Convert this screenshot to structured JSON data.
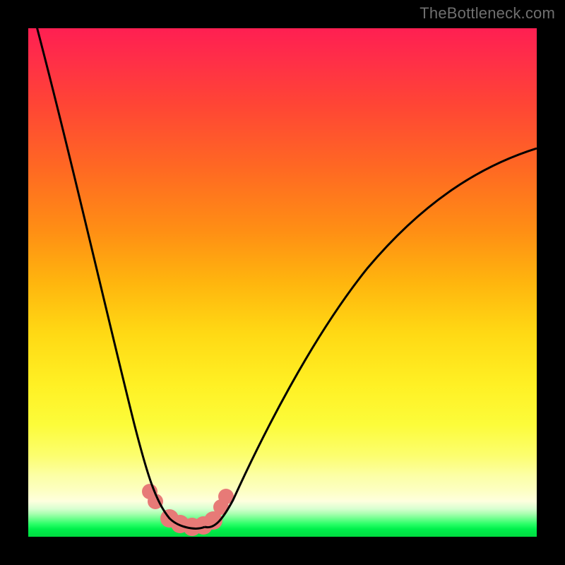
{
  "watermark": "TheBottleneck.com",
  "chart_data": {
    "type": "line",
    "title": "",
    "xlabel": "",
    "ylabel": "",
    "xlim": [
      0,
      100
    ],
    "ylim": [
      0,
      100
    ],
    "grid": false,
    "legend": false,
    "series": [
      {
        "name": "left-curve",
        "x": [
          0,
          4,
          8,
          12,
          16,
          19,
          22,
          24,
          26,
          27,
          28,
          30
        ],
        "values": [
          100,
          84,
          68,
          52,
          36,
          22,
          11,
          5,
          2,
          1,
          0,
          0
        ]
      },
      {
        "name": "right-curve",
        "x": [
          30,
          32,
          35,
          38,
          42,
          47,
          53,
          60,
          68,
          77,
          87,
          100
        ],
        "values": [
          0,
          1,
          4,
          9,
          16,
          25,
          35,
          45,
          55,
          64,
          72,
          78
        ]
      },
      {
        "name": "markers",
        "note": "salmon blobs near the minimum",
        "x": [
          24.5,
          25.5,
          28,
          30,
          32,
          34,
          35.2,
          35.8
        ],
        "values": [
          5.0,
          3.5,
          1,
          0.5,
          0.5,
          1.2,
          3.2,
          5.0
        ]
      }
    ],
    "colors": {
      "curve": "#000000",
      "markers": "#e77a77",
      "background_top": "#ff1f52",
      "background_mid": "#ffe21a",
      "background_bottom": "#00e446"
    }
  }
}
